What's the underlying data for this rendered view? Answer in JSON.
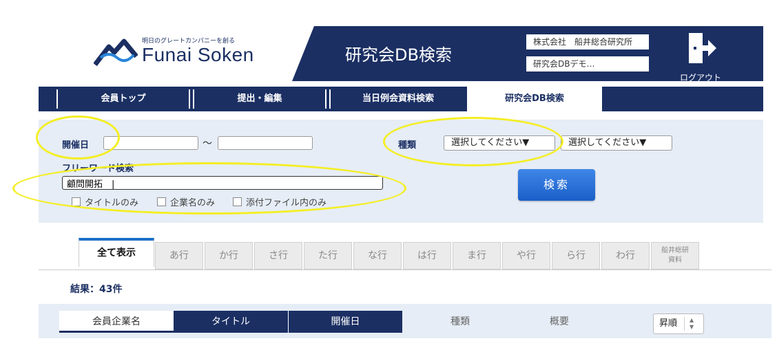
{
  "header": {
    "tagline": "明日のグレートカンパニーを創る",
    "logo_text": "Funai Soken",
    "app_title": "研究会DB検索",
    "company": "株式会社　船井総合研究所",
    "user": "研究会DBデモ…",
    "logout_label": "ログアウト",
    "brand_color": "#1b2f63"
  },
  "nav": {
    "items": [
      {
        "label": "会員トップ"
      },
      {
        "label": "提出・編集"
      },
      {
        "label": "当日例会資料検索"
      },
      {
        "label": "研究会DB検索"
      }
    ],
    "active": "研究会DB検索"
  },
  "search": {
    "date_label": "開催日",
    "date_from": "",
    "date_sep": "～",
    "date_to": "",
    "type_label": "種類",
    "type_select_1": "選択してください▼",
    "type_select_2": "選択してください▼",
    "freeword_label": "フリーワード検索",
    "freeword_value": "顧問開拓　|",
    "checkboxes": [
      {
        "label": "タイトルのみ"
      },
      {
        "label": "企業名のみ"
      },
      {
        "label": "添付ファイル内のみ"
      }
    ],
    "search_button": "検索",
    "highlight_color": "#f4ee23"
  },
  "tabs": {
    "items": [
      {
        "label": "全て表示"
      },
      {
        "label": "あ行"
      },
      {
        "label": "か行"
      },
      {
        "label": "さ行"
      },
      {
        "label": "た行"
      },
      {
        "label": "な行"
      },
      {
        "label": "は行"
      },
      {
        "label": "ま行"
      },
      {
        "label": "や行"
      },
      {
        "label": "ら行"
      },
      {
        "label": "わ行"
      }
    ],
    "last_line1": "船井総研",
    "last_line2": "資料"
  },
  "result": "結果：43件",
  "sort": {
    "columns": [
      {
        "label": "会員企業名"
      },
      {
        "label": "タイトル"
      },
      {
        "label": "開催日"
      },
      {
        "label": "種類"
      },
      {
        "label": "概要"
      }
    ],
    "order_label": "昇順"
  }
}
